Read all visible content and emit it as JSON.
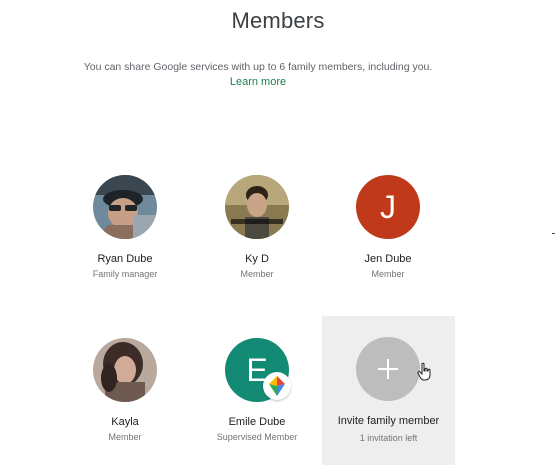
{
  "header": {
    "title": "Members",
    "subtitle": "You can share Google services with up to 6 family members, including you.",
    "learn_more": "Learn more"
  },
  "members": [
    {
      "name": "Ryan Dube",
      "role": "Family manager",
      "avatar": "photo"
    },
    {
      "name": "Ky D",
      "role": "Member",
      "avatar": "photo"
    },
    {
      "name": "Jen Dube",
      "role": "Member",
      "avatar": "letter",
      "letter": "J",
      "color": "#c1391b"
    },
    {
      "name": "Kayla",
      "role": "Member",
      "avatar": "photo"
    },
    {
      "name": "Emile Dube",
      "role": "Supervised Member",
      "avatar": "letter",
      "letter": "E",
      "color": "#138b74",
      "badge": "family-link-icon"
    }
  ],
  "invite": {
    "label": "Invite family member",
    "sublabel": "1 invitation left",
    "icon": "plus-icon"
  },
  "colors": {
    "link": "#1e7e4f",
    "tile_bg": "#eeeeee",
    "invite_circle": "#bdbdbd"
  }
}
